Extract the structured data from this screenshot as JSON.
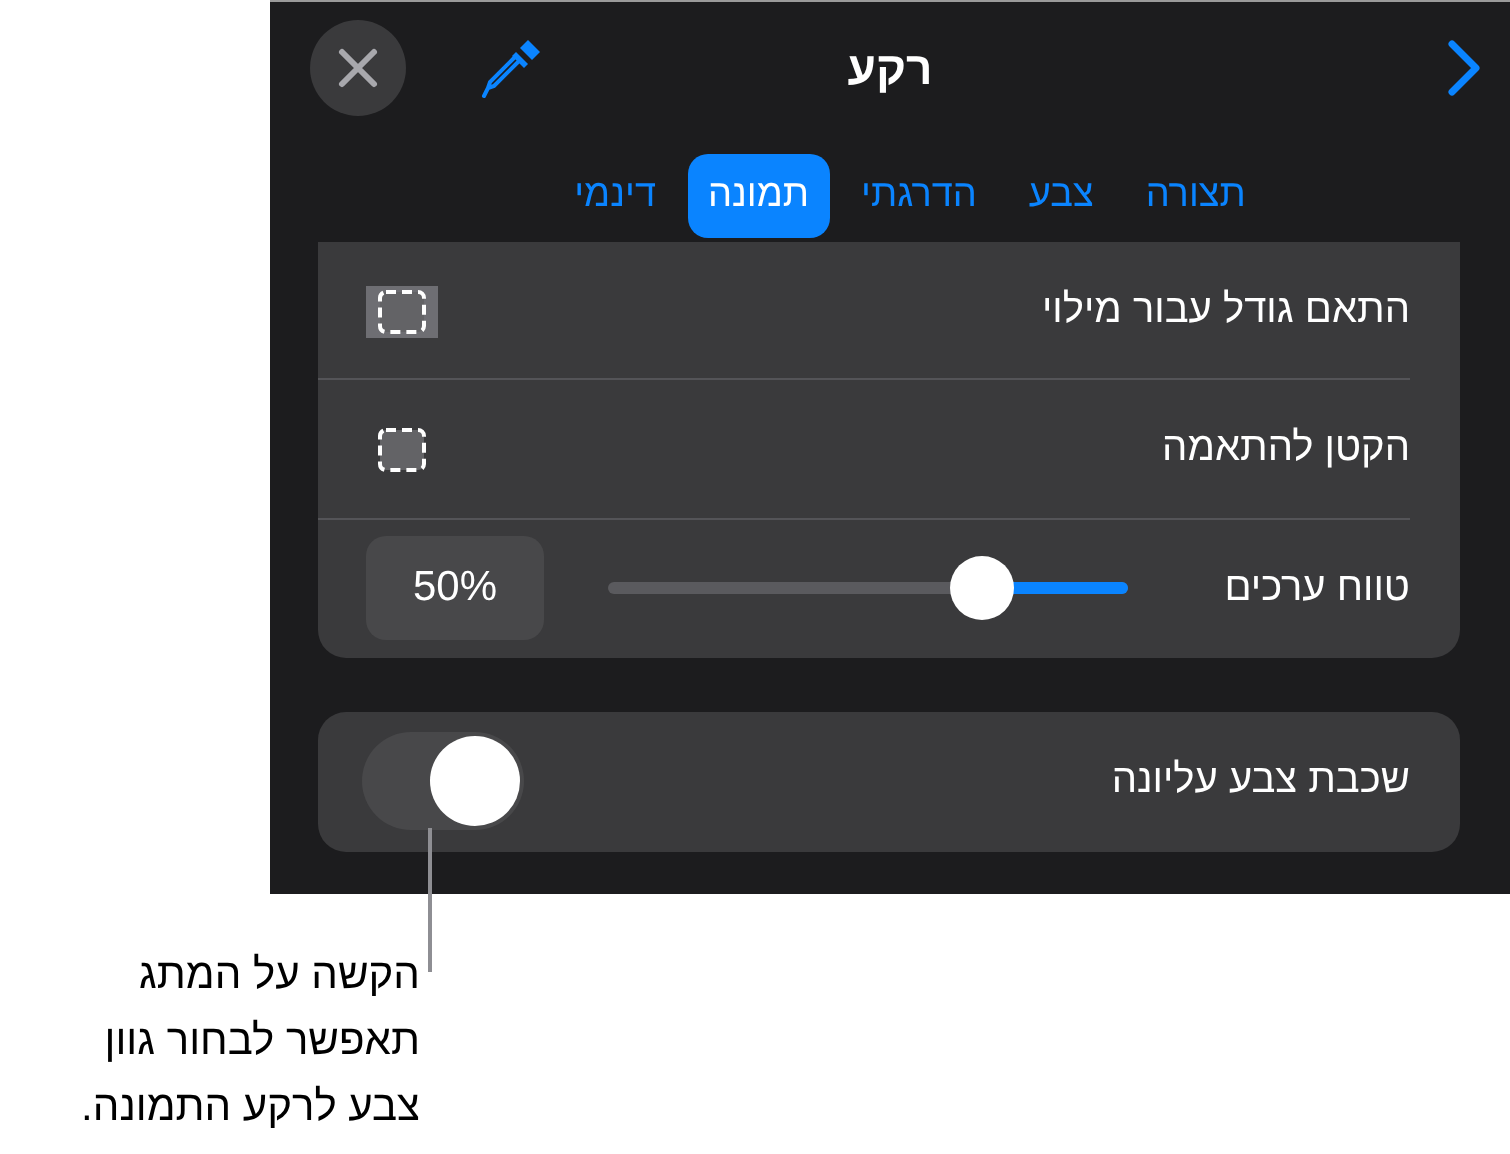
{
  "panel": {
    "title": "רקע",
    "tabs": [
      {
        "label": "תצורה",
        "selected": false
      },
      {
        "label": "צבע",
        "selected": false
      },
      {
        "label": "הדרגתי",
        "selected": false
      },
      {
        "label": "תמונה",
        "selected": true
      },
      {
        "label": "דינמי",
        "selected": false
      }
    ],
    "options": [
      {
        "label": "התאם גודל עבור מילוי",
        "selected": true
      },
      {
        "label": "הקטן להתאמה",
        "selected": false
      }
    ],
    "range": {
      "label": "טווח ערכים",
      "level": 0.28,
      "value": "50%"
    },
    "overlay": {
      "label": "שכבת צבע עליונה",
      "on": false
    }
  },
  "callout": {
    "lines": [
      "הקשה על המתג",
      "תאפשר לבחור גוון",
      "צבע לרקע התמונה."
    ]
  }
}
